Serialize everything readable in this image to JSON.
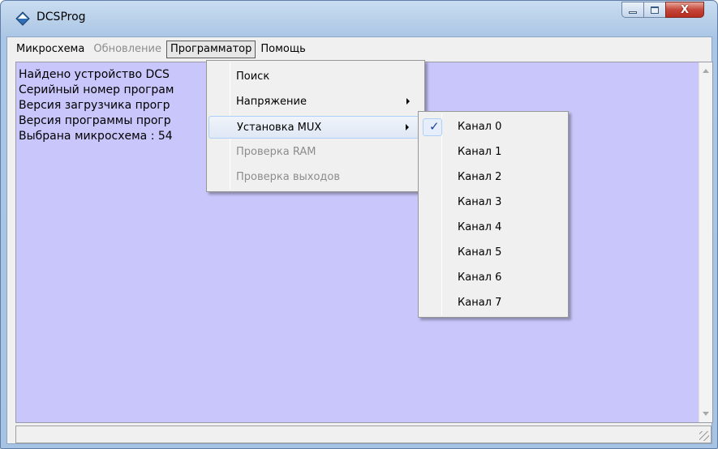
{
  "window": {
    "title": "DCSProg",
    "close_glyph": "X"
  },
  "menubar": {
    "items": [
      {
        "label": "Микросхема",
        "state": "normal"
      },
      {
        "label": "Обновление",
        "state": "disabled"
      },
      {
        "label": "Программатор",
        "state": "active"
      },
      {
        "label": "Помощь",
        "state": "normal"
      }
    ]
  },
  "log": {
    "lines": [
      "Найдено устройство DCS",
      "Серийный номер програм",
      "Версия загрузчика прогр",
      "Версия программы прогр",
      "Выбрана микросхема : 54"
    ]
  },
  "programmer_menu": {
    "items": [
      {
        "label": "Поиск",
        "enabled": true,
        "submenu": false
      },
      {
        "label": "Напряжение",
        "enabled": true,
        "submenu": true
      },
      {
        "label": "Установка MUX",
        "enabled": true,
        "submenu": true,
        "highlighted": true
      },
      {
        "label": "Проверка RAM",
        "enabled": false,
        "submenu": false
      },
      {
        "label": "Проверка выходов",
        "enabled": false,
        "submenu": false
      }
    ]
  },
  "mux_submenu": {
    "check_mark": "✓",
    "checked_index": 0,
    "items": [
      {
        "label": "Канал 0"
      },
      {
        "label": "Канал 1"
      },
      {
        "label": "Канал 2"
      },
      {
        "label": "Канал 3"
      },
      {
        "label": "Канал 4"
      },
      {
        "label": "Канал 5"
      },
      {
        "label": "Канал 6"
      },
      {
        "label": "Канал 7"
      }
    ]
  },
  "colors": {
    "log_background": "#c8c6fa",
    "highlight_border": "#aecff7",
    "check_mark": "#1e3fa0"
  }
}
